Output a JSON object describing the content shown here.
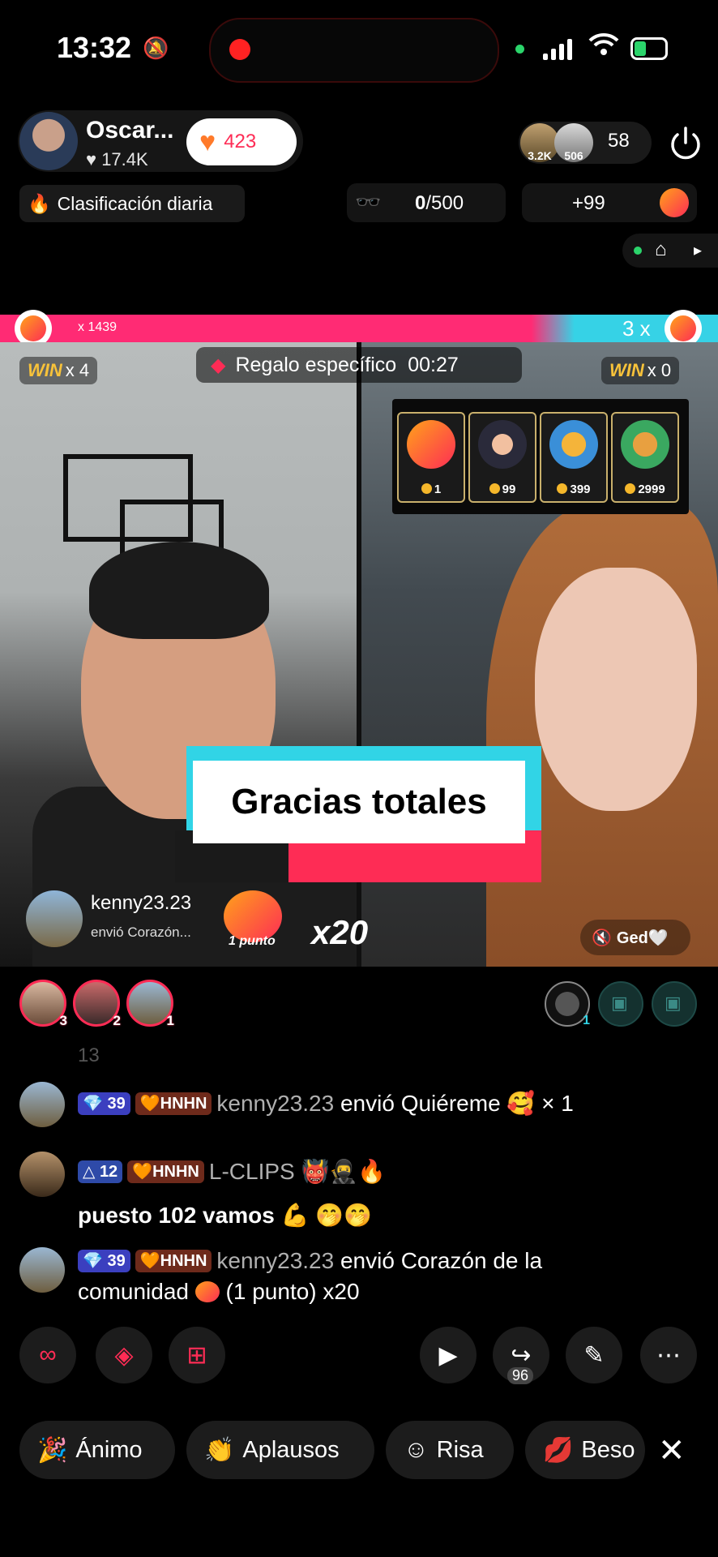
{
  "status_bar": {
    "time": "13:32"
  },
  "header": {
    "host_name": "Oscar...",
    "host_likes": "17.4K",
    "heart_count": "423",
    "viewer_badges": [
      "3.2K",
      "506"
    ],
    "viewer_count": "58",
    "daily_rank_label": "Clasificación diaria",
    "goal_current": "0",
    "goal_target": "/500",
    "plus_label": "+99"
  },
  "battle": {
    "left_multiplier": "x 1439",
    "right_multiplier": "3 x",
    "left_win": "x 4",
    "right_win": "x 0",
    "win_label": "WIN",
    "specific_gift_label": "Regalo específico",
    "timer": "00:27",
    "gift_prices": [
      "1",
      "99",
      "399",
      "2999"
    ]
  },
  "banner": {
    "text": "Gracias totales"
  },
  "gift_notice": {
    "user": "kenny23.23",
    "action": "envió Corazón...",
    "points_label": "1 punto",
    "multiplier": "x20"
  },
  "mute_label": "Ged🤍",
  "top_ranks": [
    "3",
    "2",
    "1"
  ],
  "guest_seat_number": "1",
  "chat": {
    "cut_off_text": "13",
    "messages": [
      {
        "level": "39",
        "fan_badge": "HNHN",
        "user": "kenny23.23",
        "text": "envió Quiéreme",
        "suffix": "× 1"
      },
      {
        "level": "12",
        "fan_badge": "HNHN",
        "user": "L-CLIPS",
        "emojis": "👹🥷🔥",
        "text": "puesto 102 vamos 💪 🤭🤭"
      },
      {
        "level": "39",
        "fan_badge": "HNHN",
        "user": "kenny23.23",
        "text": "envió Corazón de la",
        "text2": "comunidad",
        "suffix": "(1 punto) x20"
      }
    ]
  },
  "toolbar": {
    "share_count": "96"
  },
  "reactions": [
    "Ánimo",
    "Aplausos",
    "Risa",
    "Beso"
  ],
  "colors": {
    "accent_pink": "#fe2c55",
    "accent_cyan": "#31d4e6",
    "win_gold": "#f7c23a"
  }
}
